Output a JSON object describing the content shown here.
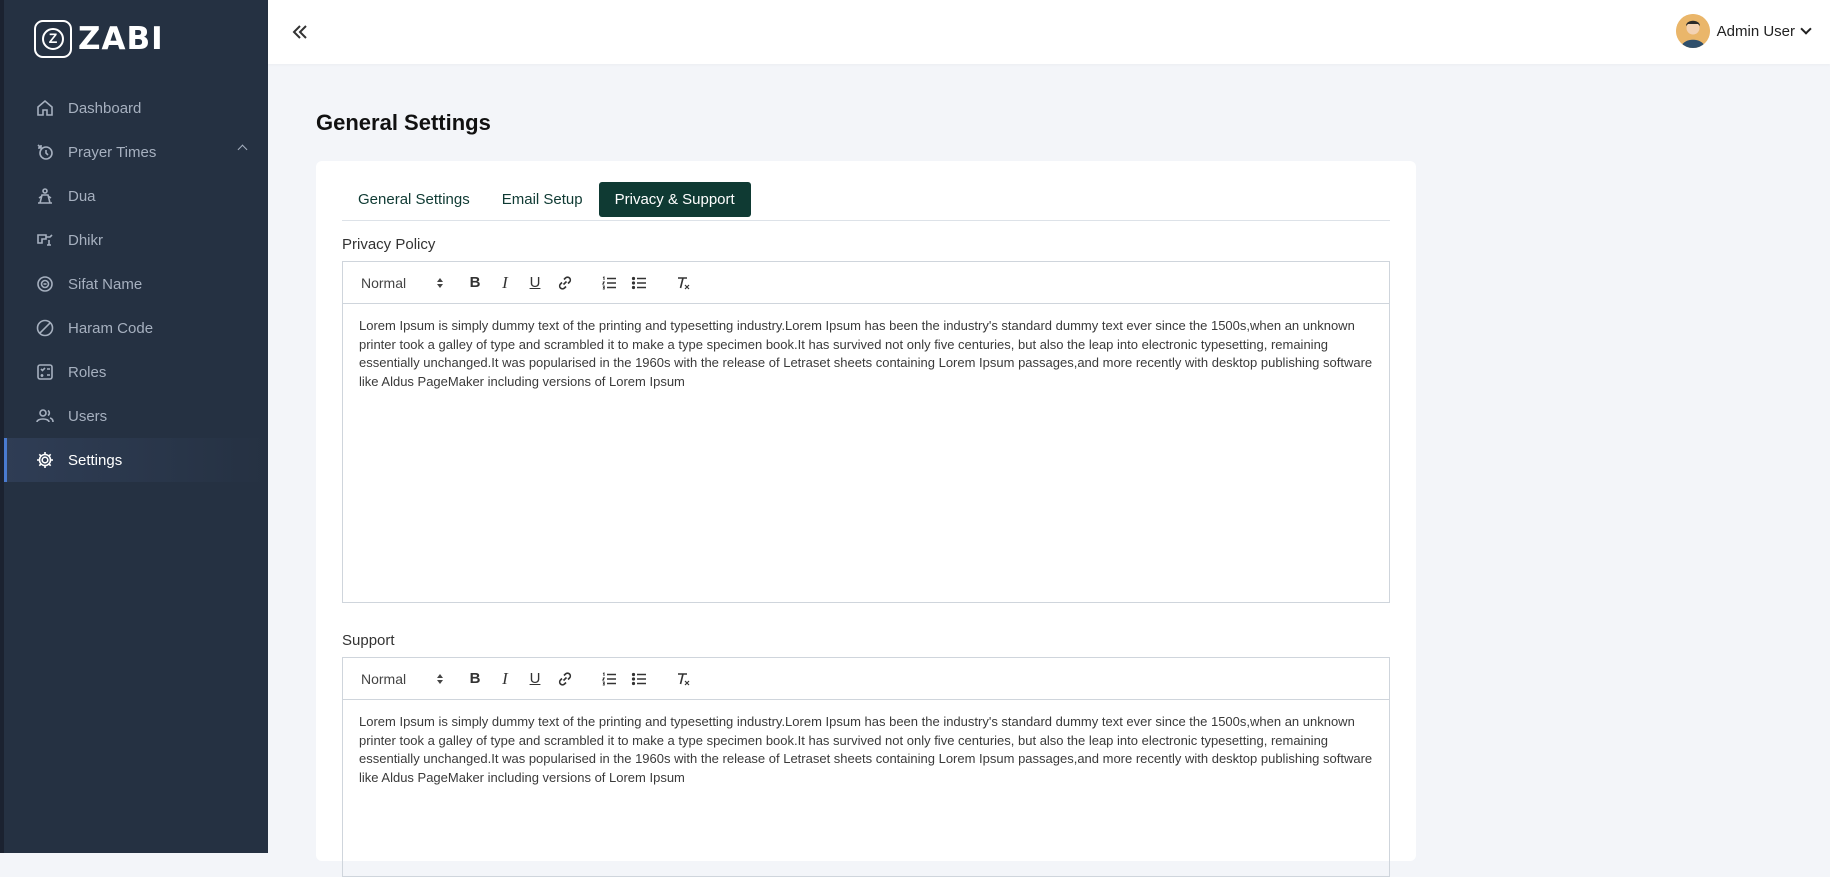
{
  "app": {
    "logo_text": "ZABI",
    "logo_mark": "Z"
  },
  "sidebar": {
    "items": [
      {
        "label": "Dashboard",
        "icon": "home-icon"
      },
      {
        "label": "Prayer Times",
        "icon": "prayer-clock-icon"
      },
      {
        "label": "Dua",
        "icon": "dua-icon"
      },
      {
        "label": "Dhikr",
        "icon": "dhikr-icon"
      },
      {
        "label": "Sifat Name",
        "icon": "sifat-icon"
      },
      {
        "label": "Haram Code",
        "icon": "prohibited-icon"
      },
      {
        "label": "Roles",
        "icon": "roles-icon"
      },
      {
        "label": "Users",
        "icon": "users-icon"
      },
      {
        "label": "Settings",
        "icon": "gear-icon"
      }
    ],
    "active_item": "Settings"
  },
  "header": {
    "user_name": "Admin User"
  },
  "page": {
    "title": "General Settings"
  },
  "tabs": [
    {
      "label": "General Settings"
    },
    {
      "label": "Email Setup"
    },
    {
      "label": "Privacy & Support"
    }
  ],
  "active_tab": "Privacy & Support",
  "privacy": {
    "label": "Privacy Policy",
    "format": "Normal",
    "text": "Lorem Ipsum is simply dummy text of the printing and typesetting industry.Lorem Ipsum has been the industry's standard dummy text ever since the 1500s,when an unknown printer took a galley of type and scrambled it to make a type specimen book.It has survived not only five centuries, but also the leap into electronic typesetting, remaining essentially unchanged.It was popularised in the 1960s with the release of Letraset sheets containing Lorem Ipsum passages,and more recently with desktop publishing software like Aldus PageMaker including versions of Lorem Ipsum"
  },
  "support": {
    "label": "Support",
    "format": "Normal",
    "text": "Lorem Ipsum is simply dummy text of the printing and typesetting industry.Lorem Ipsum has been the industry's standard dummy text ever since the 1500s,when an unknown printer took a galley of type and scrambled it to make a type specimen book.It has survived not only five centuries, but also the leap into electronic typesetting, remaining essentially unchanged.It was popularised in the 1960s with the release of Letraset sheets containing Lorem Ipsum passages,and more recently with desktop publishing software like Aldus PageMaker including versions of Lorem Ipsum"
  },
  "toolbar": {
    "bold": "B",
    "italic": "I",
    "underline": "U"
  },
  "colors": {
    "sidebar": "#253142",
    "accent": "#0f3a33",
    "active_indicator": "#4a7bd0",
    "page_bg": "#f3f5f9"
  }
}
